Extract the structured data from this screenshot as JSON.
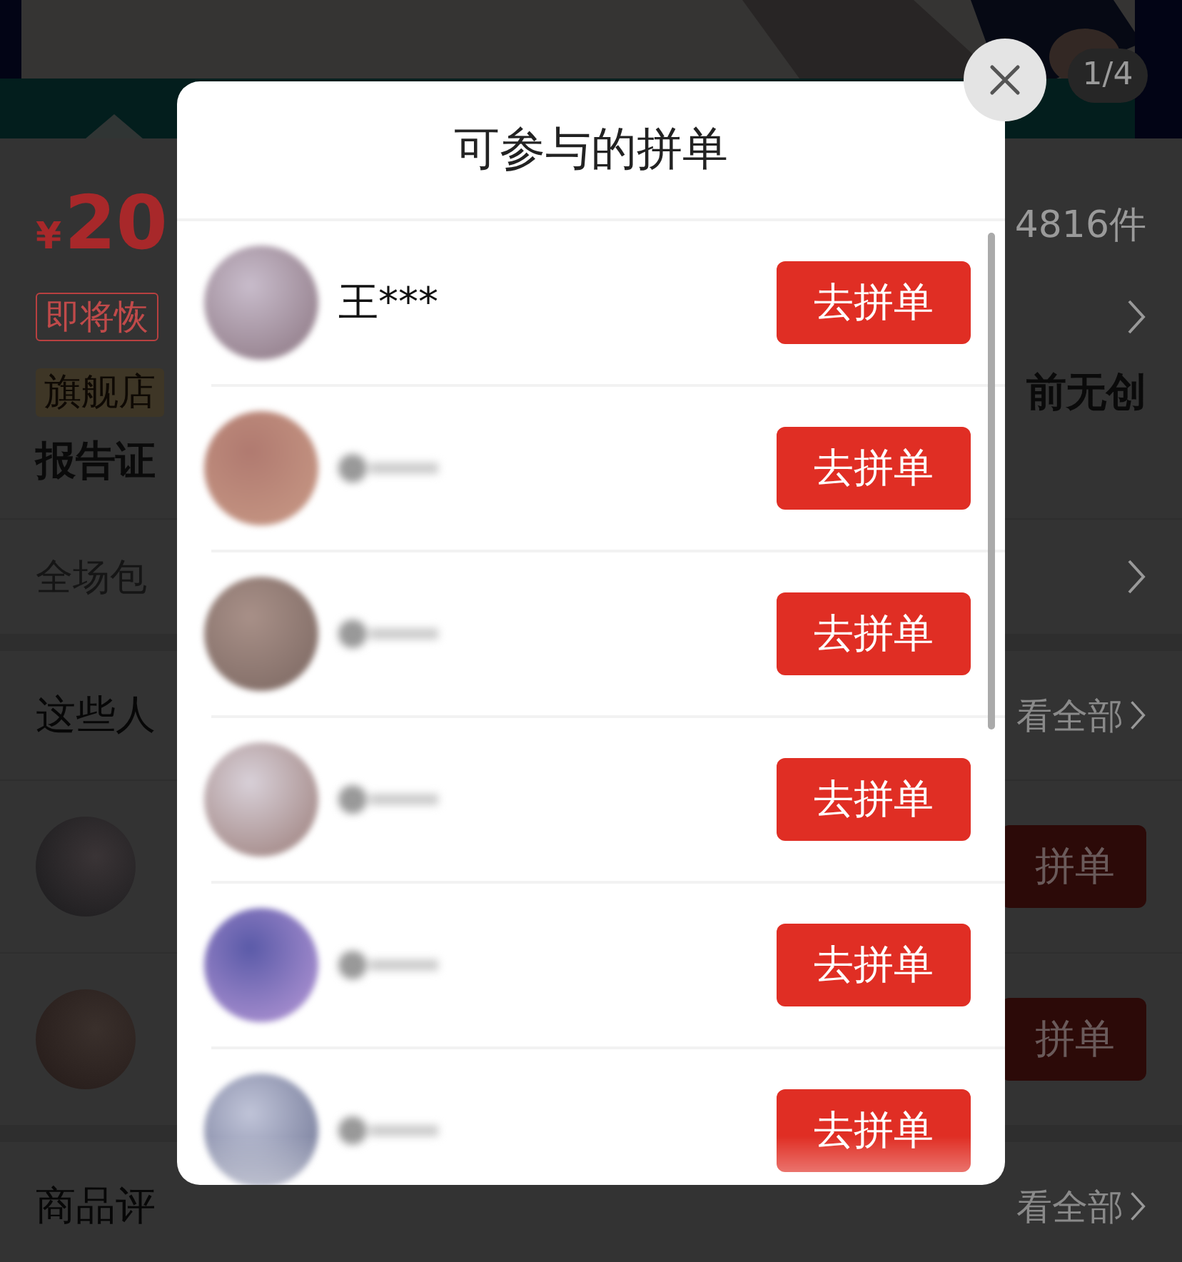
{
  "background_page": {
    "gallery_counter": "1/4",
    "price": {
      "currency": "¥",
      "amount": "20"
    },
    "sold_count": "4816件",
    "status_tag": "即将恢",
    "store_badge": "旗舰店",
    "title_line_1_end": "前无创",
    "title_line_2_start": "报告证",
    "shipping": "全场包",
    "group_section": {
      "title": "这些人",
      "view_all": "看全部",
      "rows": [
        {
          "button": "拼单"
        },
        {
          "button": "拼单"
        }
      ]
    },
    "reviews": {
      "title": "商品评",
      "view_all": "看全部"
    }
  },
  "modal": {
    "title": "可参与的拼单",
    "participants": [
      {
        "name": "王***",
        "blurred": false,
        "button": "去拼单"
      },
      {
        "blurred": true,
        "button": "去拼单"
      },
      {
        "blurred": true,
        "button": "去拼单"
      },
      {
        "blurred": true,
        "button": "去拼单"
      },
      {
        "blurred": true,
        "button": "去拼单"
      },
      {
        "blurred": true,
        "button": "去拼单"
      }
    ]
  }
}
